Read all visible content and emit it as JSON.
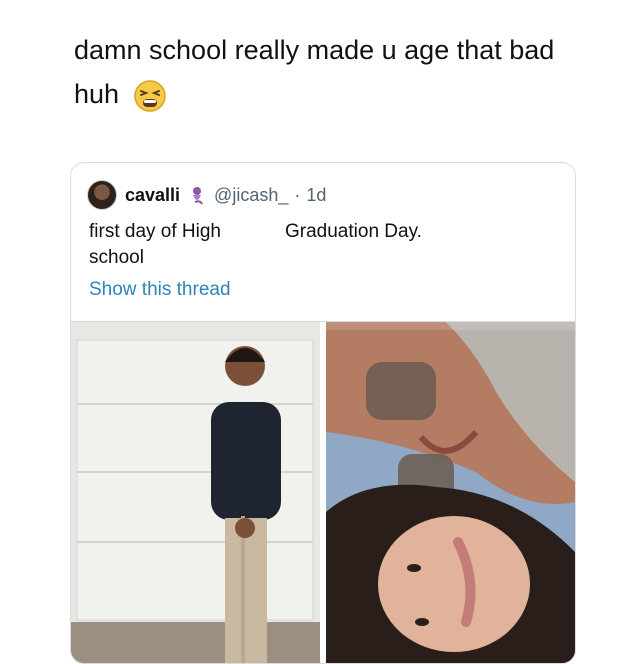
{
  "caption": {
    "text": "damn school really made u age that bad huh",
    "emoji": "tired-face-emoji"
  },
  "tweet": {
    "display_name": "cavalli",
    "badge_icon": "genie-emoji",
    "handle": "@jicash_",
    "separator": "·",
    "time": "1d",
    "text_left": "first day of High school",
    "text_right": "Graduation Day.",
    "show_thread": "Show this thread",
    "link_color": "#2b86b8"
  },
  "media": {
    "left_photo": "student-first-day-photo",
    "right_photo": "selfie-graduation-photo"
  }
}
